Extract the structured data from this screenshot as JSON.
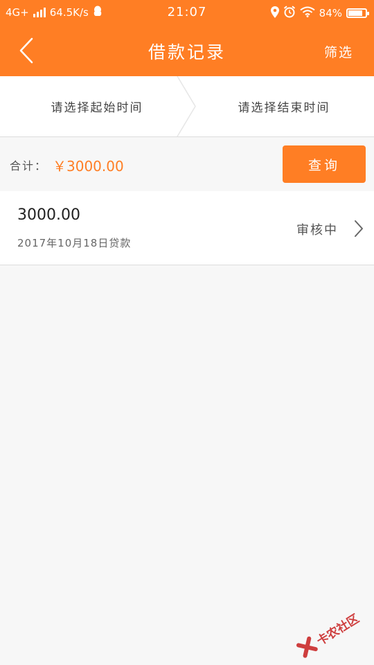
{
  "status_bar": {
    "network": "4G+",
    "speed": "64.5K/s",
    "time": "21:07",
    "battery": "84%",
    "battery_level": 0.84
  },
  "nav": {
    "title": "借款记录",
    "filter_label": "筛选"
  },
  "date_range": {
    "start_placeholder": "请选择起始时间",
    "end_placeholder": "请选择结束时间"
  },
  "summary": {
    "total_label": "合计：",
    "total_amount": "￥3000.00",
    "query_label": "查询"
  },
  "records": [
    {
      "amount": "3000.00",
      "date": "2017年10月18日贷款",
      "status": "审核中"
    }
  ],
  "watermark": {
    "text": "卡农社区"
  },
  "colors": {
    "accent": "#ff7e24",
    "background": "#f7f7f7",
    "watermark": "#c81e1e"
  },
  "icons": {
    "back": "chevron-left-icon",
    "record_arrow": "chevron-right-icon",
    "location": "location-icon",
    "alarm": "alarm-icon",
    "wifi": "wifi-icon",
    "battery": "battery-icon",
    "notification": "qq-notification-icon"
  }
}
